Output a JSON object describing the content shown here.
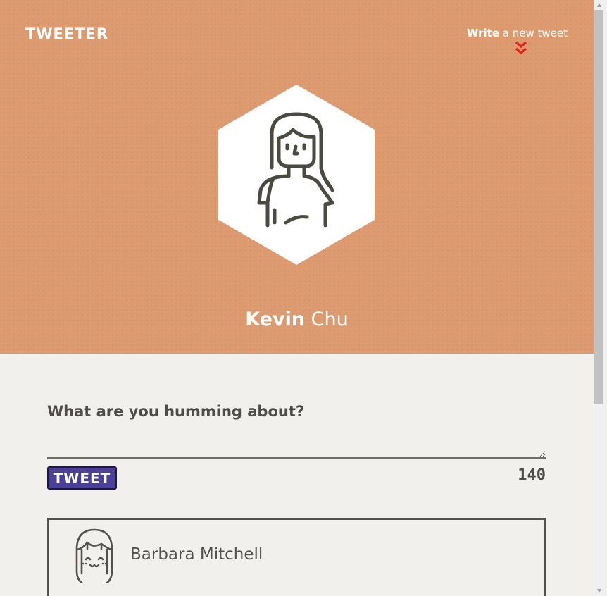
{
  "header": {
    "logo": "TWEETER",
    "write_bold": "Write",
    "write_rest": " a new tweet",
    "background_color": "#dc9a6e"
  },
  "profile": {
    "first_name": "Kevin",
    "last_name": " Chu",
    "avatar_icon": "woman-long-hair-avatar-icon"
  },
  "compose": {
    "label": "What are you humming about?",
    "input_value": "",
    "button_label": "TWEET",
    "counter": "140",
    "button_color": "#4c3f9a"
  },
  "tweets": [
    {
      "author": "Barbara Mitchell",
      "avatar_icon": "girl-bangs-avatar-icon"
    }
  ]
}
